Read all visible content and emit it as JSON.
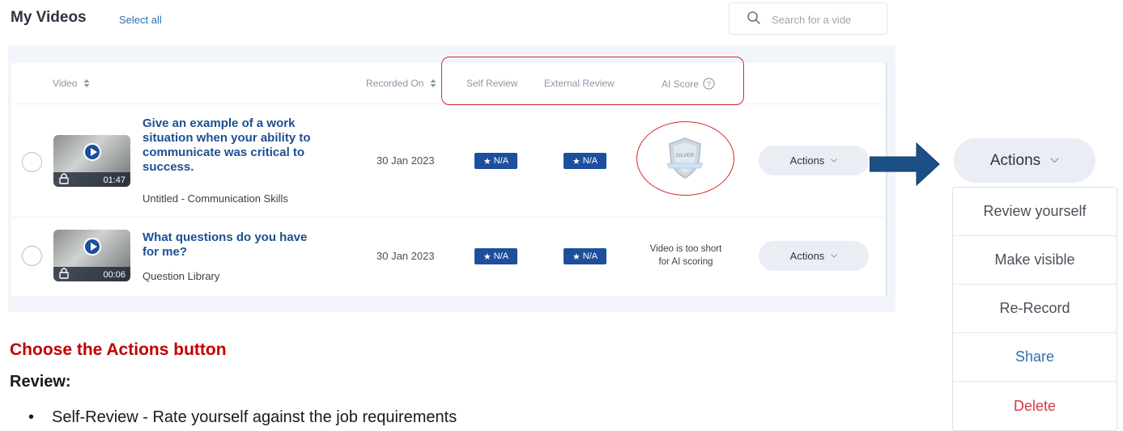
{
  "header": {
    "title": "My Videos",
    "select_all": "Select all",
    "search_placeholder": "Search for a vide"
  },
  "table": {
    "columns": {
      "video": "Video",
      "recorded_on": "Recorded On",
      "self_review": "Self Review",
      "external_review": "External Review",
      "ai_score": "AI Score"
    },
    "rows": [
      {
        "title_lines": [
          "Give an example of a work",
          "situation when your ability to",
          "communicate was critical to",
          "success."
        ],
        "subtitle": "Untitled - Communication Skills",
        "duration": "01:47",
        "recorded_on": "30 Jan 2023",
        "self_review": "N/A",
        "external_review": "N/A",
        "ai_score_badge": "SILVER",
        "actions_label": "Actions"
      },
      {
        "title_lines": [
          "What questions do you have",
          "for me?"
        ],
        "subtitle": "Question Library",
        "duration": "00:06",
        "recorded_on": "30 Jan 2023",
        "self_review": "N/A",
        "external_review": "N/A",
        "ai_score_text_lines": [
          "Video is too short",
          "for AI scoring"
        ],
        "actions_label": "Actions"
      }
    ]
  },
  "popup": {
    "actions_label": "Actions",
    "menu": [
      "Review yourself",
      "Make visible",
      "Re-Record",
      "Share",
      "Delete"
    ]
  },
  "instructions": {
    "heading": "Choose the Actions button",
    "review_heading": "Review:",
    "bullet": "Self-Review - Rate yourself against the job requirements"
  },
  "colors": {
    "accent_blue": "#1d4f9c",
    "annotation_red": "#d3272a",
    "instruction_red": "#c00000",
    "delete_red": "#d33a44"
  }
}
